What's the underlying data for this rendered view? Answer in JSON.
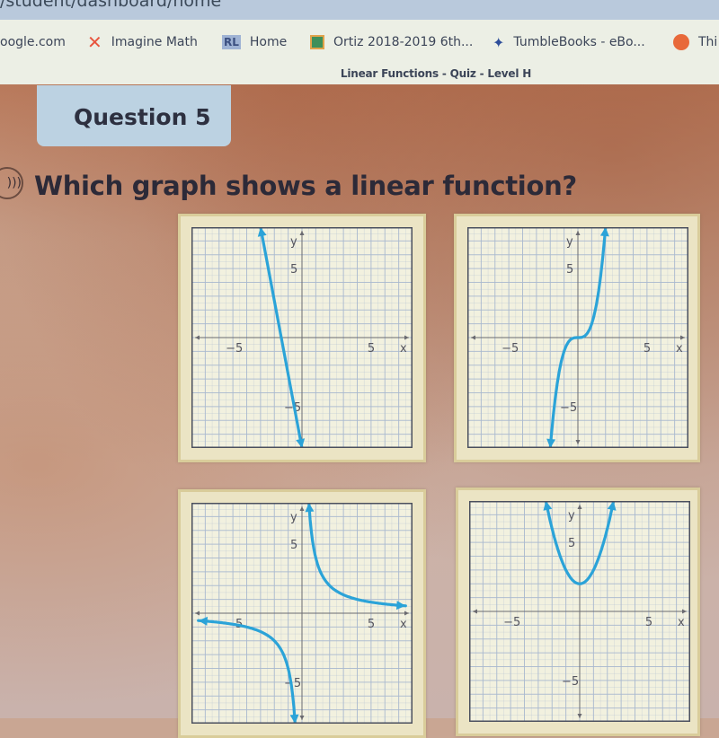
{
  "browser": {
    "url_fragment": "/student/dashboard/home",
    "bookmarks": [
      {
        "label": "oogle.com",
        "icon": "google-partial"
      },
      {
        "label": "Imagine Math",
        "icon": "imagine-math-figure-icon"
      },
      {
        "label": "Home",
        "icon": "rl-badge-icon",
        "badge": "RL"
      },
      {
        "label": "Ortiz 2018-2019 6th...",
        "icon": "classroom-icon"
      },
      {
        "label": "TumbleBooks - eBo...",
        "icon": "tumblebooks-kangaroo-icon"
      },
      {
        "label": "Thi",
        "icon": "orange-circle-icon"
      }
    ],
    "page_title": "Linear Functions - Quiz - Level H"
  },
  "quiz": {
    "question_tab": "Question 5",
    "question_text": "Which graph shows a linear function?",
    "audio_icon": "speaker-icon"
  },
  "colors": {
    "curve": "#2ba3d8",
    "grid_minor": "#a9b9cf",
    "grid_border": "#4a4f5e",
    "axis": "#6a6a70",
    "card_bg": "#f2f1df",
    "tab_bg": "#bcd2e2"
  },
  "chart_data": [
    {
      "type": "line",
      "id": "graph-a",
      "description": "steep decreasing straight line",
      "xlabel": "x",
      "ylabel": "y",
      "xlim": [
        -8,
        8
      ],
      "ylim": [
        -8,
        8
      ],
      "x_ticks_labeled": [
        -5,
        5
      ],
      "y_ticks_labeled": [
        5,
        -5
      ],
      "grid": true,
      "series": [
        {
          "name": "line",
          "function": "y = -16/3*x - 8",
          "points": [
            [
              -3,
              8
            ],
            [
              0,
              -8
            ]
          ],
          "arrows": "both"
        }
      ]
    },
    {
      "type": "line",
      "id": "graph-b",
      "description": "cubic curve",
      "xlabel": "x",
      "ylabel": "y",
      "xlim": [
        -8,
        8
      ],
      "ylim": [
        -8,
        8
      ],
      "x_ticks_labeled": [
        -5,
        5
      ],
      "y_ticks_labeled": [
        5,
        -5
      ],
      "grid": true,
      "series": [
        {
          "name": "cubic",
          "function": "y = x^3",
          "x_range": [
            -2,
            2
          ],
          "arrows": "both"
        }
      ]
    },
    {
      "type": "line",
      "id": "graph-c",
      "description": "reciprocal (hyperbola) curve",
      "xlabel": "x",
      "ylabel": "y",
      "xlim": [
        -8,
        8
      ],
      "ylim": [
        -8,
        8
      ],
      "x_ticks_labeled": [
        -5,
        5
      ],
      "y_ticks_labeled": [
        5,
        -5
      ],
      "grid": true,
      "series": [
        {
          "name": "upper-branch",
          "function": "y = 4/x",
          "x_range": [
            0.5,
            7.5
          ],
          "arrows": "both"
        },
        {
          "name": "lower-branch",
          "function": "y = 4/x",
          "x_range": [
            -7.5,
            -0.5
          ],
          "arrows": "both"
        }
      ]
    },
    {
      "type": "line",
      "id": "graph-d",
      "description": "upward parabola with vertex (0,2)",
      "xlabel": "x",
      "ylabel": "y",
      "xlim": [
        -8,
        8
      ],
      "ylim": [
        -8,
        8
      ],
      "x_ticks_labeled": [
        -5,
        5
      ],
      "y_ticks_labeled": [
        5,
        -5
      ],
      "grid": true,
      "series": [
        {
          "name": "parabola",
          "function": "y = x^2 + 2",
          "x_range": [
            -2.45,
            2.45
          ],
          "arrows": "both"
        }
      ]
    }
  ]
}
